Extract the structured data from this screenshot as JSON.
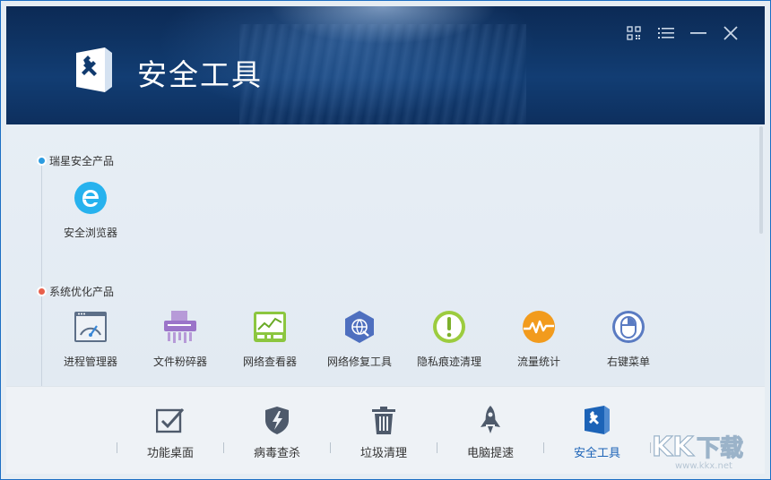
{
  "app": {
    "title": "安全工具"
  },
  "window_controls": [
    "qr-code-icon",
    "menu-icon",
    "minimize-icon",
    "close-icon"
  ],
  "sections": [
    {
      "label": "瑞星安全产品",
      "dot_color": "#2b9be0",
      "items": [
        {
          "label": "安全浏览器",
          "icon": "browser-e-icon"
        }
      ]
    },
    {
      "label": "系统优化产品",
      "dot_color": "#e8604c",
      "items": [
        {
          "label": "进程管理器",
          "icon": "process-manager-icon"
        },
        {
          "label": "文件粉碎器",
          "icon": "file-shredder-icon"
        },
        {
          "label": "网络查看器",
          "icon": "network-viewer-icon"
        },
        {
          "label": "网络修复工具",
          "icon": "network-repair-icon"
        },
        {
          "label": "隐私痕迹清理",
          "icon": "privacy-clean-icon"
        },
        {
          "label": "流量统计",
          "icon": "traffic-stats-icon"
        },
        {
          "label": "右键菜单",
          "icon": "mouse-icon"
        }
      ]
    }
  ],
  "bottom_nav": [
    {
      "label": "功能桌面",
      "icon": "checkbox-icon",
      "active": false
    },
    {
      "label": "病毒查杀",
      "icon": "shield-bolt-icon",
      "active": false
    },
    {
      "label": "垃圾清理",
      "icon": "trash-icon",
      "active": false
    },
    {
      "label": "电脑提速",
      "icon": "rocket-icon",
      "active": false
    },
    {
      "label": "安全工具",
      "icon": "wrench-tools-icon",
      "active": true
    }
  ],
  "watermark": {
    "text": "KK下载",
    "sub": "www.kkx.net"
  },
  "colors": {
    "accent": "#1c63b7",
    "header_dark": "#0f3566",
    "icon_gray": "#4e5a6b"
  }
}
